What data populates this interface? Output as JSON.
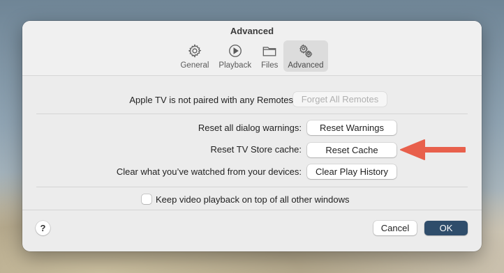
{
  "window": {
    "title": "Advanced"
  },
  "tabs": [
    {
      "label": "General",
      "icon": "gear-icon",
      "active": false
    },
    {
      "label": "Playback",
      "icon": "play-circle-icon",
      "active": false
    },
    {
      "label": "Files",
      "icon": "folder-icon",
      "active": false
    },
    {
      "label": "Advanced",
      "icon": "gears-icon",
      "active": true
    }
  ],
  "remotes": {
    "label": "Apple TV is not paired with any Remotes",
    "button": "Forget All Remotes",
    "button_disabled": true
  },
  "settings": {
    "warnings_label": "Reset all dialog warnings:",
    "warnings_button": "Reset Warnings",
    "cache_label": "Reset TV Store cache:",
    "cache_button": "Reset Cache",
    "history_label": "Clear what you’ve watched from your devices:",
    "history_button": "Clear Play History"
  },
  "options": {
    "keep_on_top_label": "Keep video playback on top of all other windows",
    "keep_on_top_checked": false
  },
  "footer": {
    "help": "?",
    "cancel": "Cancel",
    "ok": "OK"
  },
  "colors": {
    "primary_button": "#2f4d6b",
    "annotation_arrow": "#e8604c"
  }
}
